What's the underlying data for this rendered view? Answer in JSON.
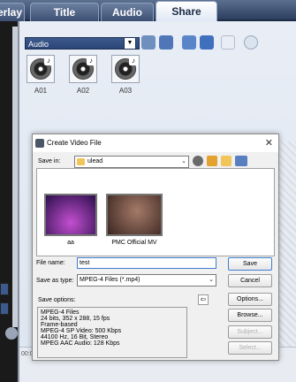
{
  "tabs": [
    {
      "label": "erlay"
    },
    {
      "label": "Title"
    },
    {
      "label": "Audio"
    },
    {
      "label": "Share"
    }
  ],
  "library": {
    "category": "Audio",
    "thumbs": [
      {
        "label": "A01"
      },
      {
        "label": "A02"
      },
      {
        "label": "A03"
      }
    ]
  },
  "timeline": {
    "ruler": "00:0"
  },
  "dialog": {
    "title": "Create Video File",
    "save_in_label": "Save in:",
    "save_in_value": "ulead",
    "files": [
      {
        "name": "aa"
      },
      {
        "name": "PMC Official MV"
      }
    ],
    "file_name_label": "File name:",
    "file_name_value": "test",
    "save_as_type_label": "Save as type:",
    "save_as_type_value": "MPEG-4 Files (*.mp4)",
    "save_options_label": "Save options:",
    "save_options": [
      "MPEG-4 Files",
      "24 bits, 352 x 288, 15 fps",
      "Frame-based",
      "MPEG-4 SP Video: 500 Kbps",
      "44100 Hz, 16 Bit, Stereo",
      "MPEG AAC Audio: 128 Kbps"
    ],
    "buttons": {
      "save": "Save",
      "cancel": "Cancel",
      "options": "Options...",
      "browse": "Browse...",
      "subject": "Subject...",
      "select": "Select..."
    }
  },
  "icons": {
    "tb1": "folder-icon",
    "tb2": "import-icon",
    "tb3": "list-icon",
    "tb4": "cd-icon",
    "tb5": "copy-icon",
    "tb6": "expand-icon"
  }
}
